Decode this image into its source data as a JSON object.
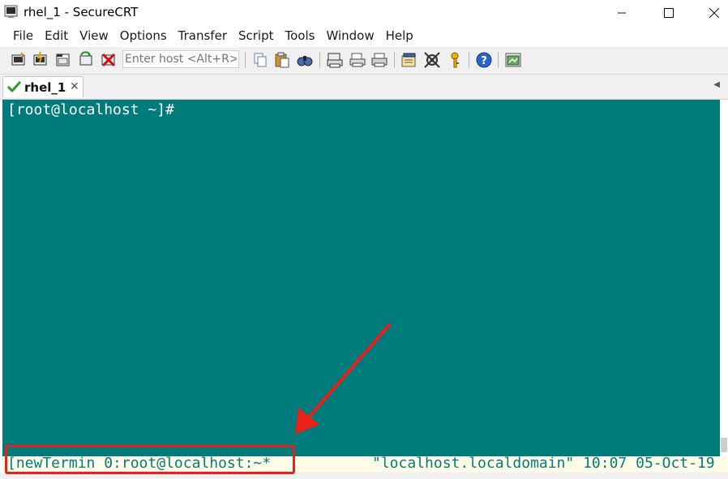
{
  "window": {
    "title": "rhel_1 - SecureCRT"
  },
  "menu": {
    "items": [
      "File",
      "Edit",
      "View",
      "Options",
      "Transfer",
      "Script",
      "Tools",
      "Window",
      "Help"
    ]
  },
  "toolbar": {
    "host_placeholder": "Enter host <Alt+R>",
    "icons": [
      "connect-icon",
      "quick-connect-icon",
      "connect-in-tab-icon",
      "reconnect-icon",
      "disconnect-icon",
      "copy-icon",
      "paste-icon",
      "find-icon",
      "print-screen-icon",
      "print-selection-icon",
      "print-icon",
      "session-options-icon",
      "global-options-icon",
      "keymap-icon",
      "help-icon",
      "sftp-icon"
    ]
  },
  "tabs": [
    {
      "label": "rhel_1",
      "active": true,
      "status_icon": "connected-check-icon"
    }
  ],
  "terminal": {
    "prompt": "[root@localhost ~]#",
    "background_color": "#007b7b",
    "text_color": "#ffffff"
  },
  "status_line": {
    "left": "[newTermin 0:root@localhost:~*",
    "right": "\"localhost.localdomain\" 10:07 05-Oct-19"
  },
  "annotation": {
    "color": "#e8221b"
  }
}
